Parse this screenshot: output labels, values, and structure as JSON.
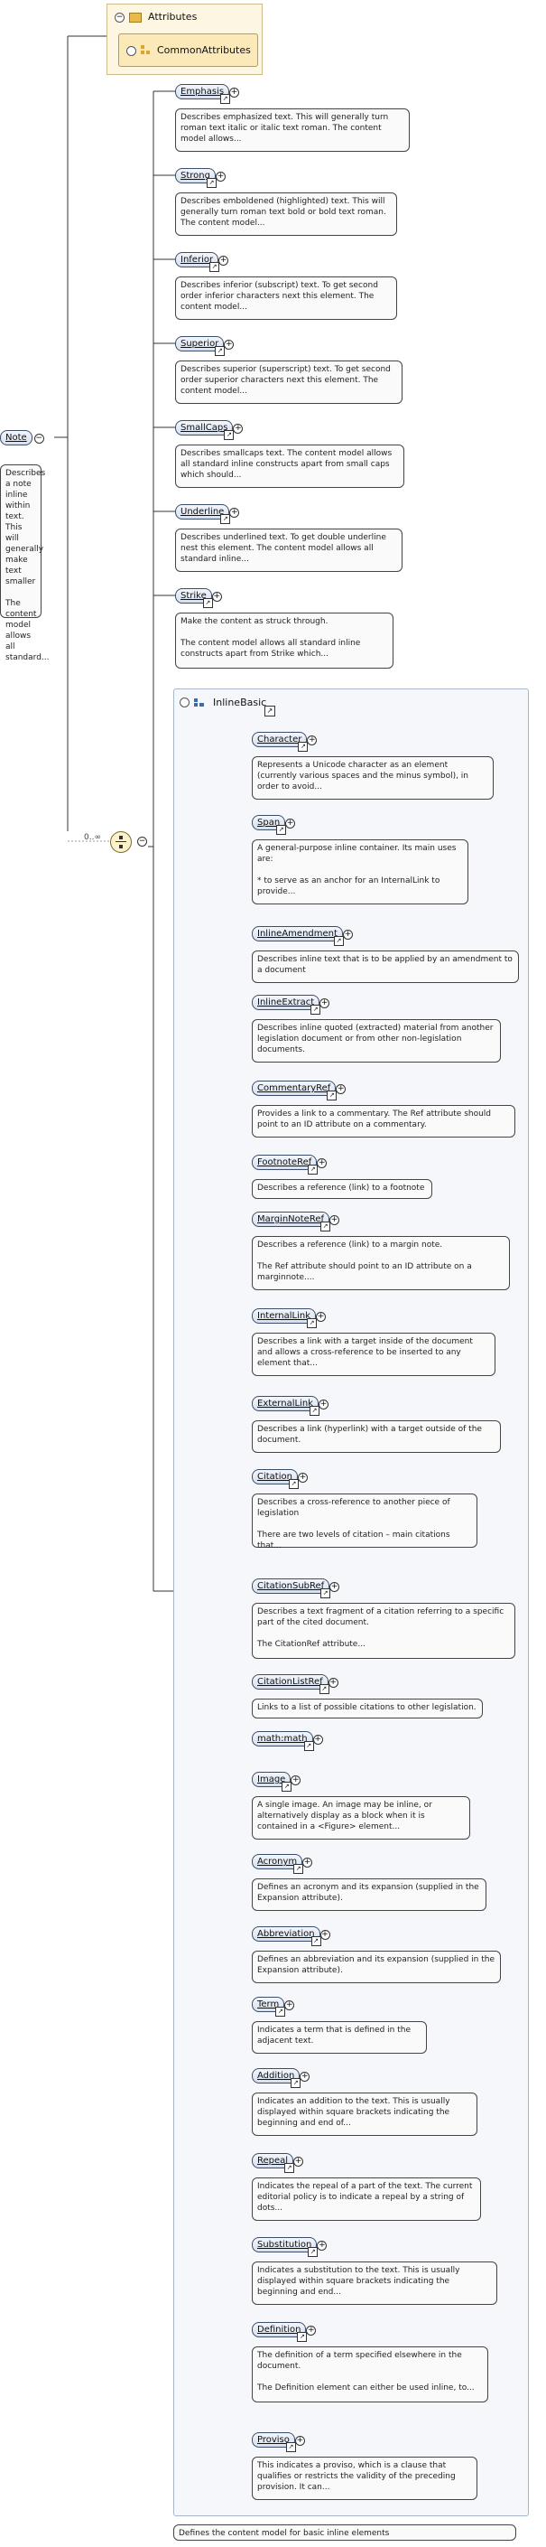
{
  "root": {
    "name": "Note",
    "description": "Describes a note inline within text. This will generally make text smaller\n\nThe content model allows all standard..."
  },
  "attributes": {
    "title": "Attributes",
    "group": "CommonAttributes"
  },
  "outer_cardinality": "0..∞",
  "outer_children": [
    {
      "name": "Emphasis",
      "description": "Describes emphasized text. This will generally turn roman text italic or italic text roman. The content model allows..."
    },
    {
      "name": "Strong",
      "description": "Describes emboldened (highlighted) text. This will generally turn roman text bold or bold text roman. The content model..."
    },
    {
      "name": "Inferior",
      "description": "Describes inferior (subscript) text. To get second order inferior characters next this element. The content model..."
    },
    {
      "name": "Superior",
      "description": "Describes superior (superscript) text. To get second order superior characters next this element. The content model..."
    },
    {
      "name": "SmallCaps",
      "description": "Describes smallcaps text. The content model allows all standard inline constructs apart from small caps which should..."
    },
    {
      "name": "Underline",
      "description": "Describes underlined text. To get double underline nest this element. The content model allows all standard inline..."
    },
    {
      "name": "Strike",
      "description": "Make the content as struck through.\n\nThe content model allows all standard inline constructs apart from Strike which..."
    }
  ],
  "inline_group": {
    "name": "InlineBasic",
    "description": "Defines the content model for basic inline elements"
  },
  "inline_children": [
    {
      "name": "Character",
      "description": "Represents a Unicode character as an element (currently various spaces and the minus symbol), in order to avoid..."
    },
    {
      "name": "Span",
      "description": "A general-purpose inline container. Its main uses are:\n\n* to serve as an anchor for an InternalLink to provide..."
    },
    {
      "name": "InlineAmendment",
      "description": "Describes inline text that is to be applied by an amendment to a document"
    },
    {
      "name": "InlineExtract",
      "description": "Describes inline quoted (extracted) material from another legislation document or from other non-legislation documents."
    },
    {
      "name": "CommentaryRef",
      "description": "Provides a link to a commentary. The Ref attribute should point to an ID attribute on a commentary."
    },
    {
      "name": "FootnoteRef",
      "description": "Describes a reference (link) to a footnote"
    },
    {
      "name": "MarginNoteRef",
      "description": "Describes a reference (link) to a margin note.\n\nThe Ref attribute should point to an ID attribute on a marginnote...."
    },
    {
      "name": "InternalLink",
      "description": "Describes a link with a target inside of the document and allows a cross-reference to be inserted to any element that..."
    },
    {
      "name": "ExternalLink",
      "description": "Describes a link (hyperlink) with a target outside of the document."
    },
    {
      "name": "Citation",
      "description": "Describes a cross-reference to another piece of legislation\n\nThere are two levels of citation – main citations that..."
    },
    {
      "name": "CitationSubRef",
      "description": "Describes a text fragment of a citation referring to a specific part of the cited document.\n\nThe CitationRef attribute..."
    },
    {
      "name": "CitationListRef",
      "description": "Links to a list of possible citations to other legislation."
    },
    {
      "name": "math:math",
      "description": ""
    },
    {
      "name": "Image",
      "description": "A single image. An image may be inline, or alternatively display as a block when it is contained in a <Figure> element..."
    },
    {
      "name": "Acronym",
      "description": "Defines an acronym and its expansion (supplied in the Expansion attribute)."
    },
    {
      "name": "Abbreviation",
      "description": "Defines an abbreviation and its expansion (supplied in the Expansion attribute)."
    },
    {
      "name": "Term",
      "description": "Indicates a term that is defined in the adjacent text."
    },
    {
      "name": "Addition",
      "description": "Indicates an addition to the text. This is usually displayed within square brackets indicating the beginning and end of..."
    },
    {
      "name": "Repeal",
      "description": "Indicates the repeal of a part of the text. The current editorial policy is to indicate a repeal by a string of dots..."
    },
    {
      "name": "Substitution",
      "description": "Indicates a substitution to the text. This is usually displayed within square brackets indicating the beginning and end..."
    },
    {
      "name": "Definition",
      "description": "The definition of a term specified elsewhere in the document.\n\nThe Definition element can either be used inline, to..."
    },
    {
      "name": "Proviso",
      "description": "This indicates a proviso, which is a clause that qualifies or restricts the validity of the preceding provision. It can..."
    }
  ],
  "colors": {
    "element_fill": "#d6e0ef",
    "element_border": "#3c4e6b",
    "attributes_fill": "#fdf6e3",
    "group_fill": "#f5f7fb",
    "sequence_fill": "#fbf2cc"
  }
}
